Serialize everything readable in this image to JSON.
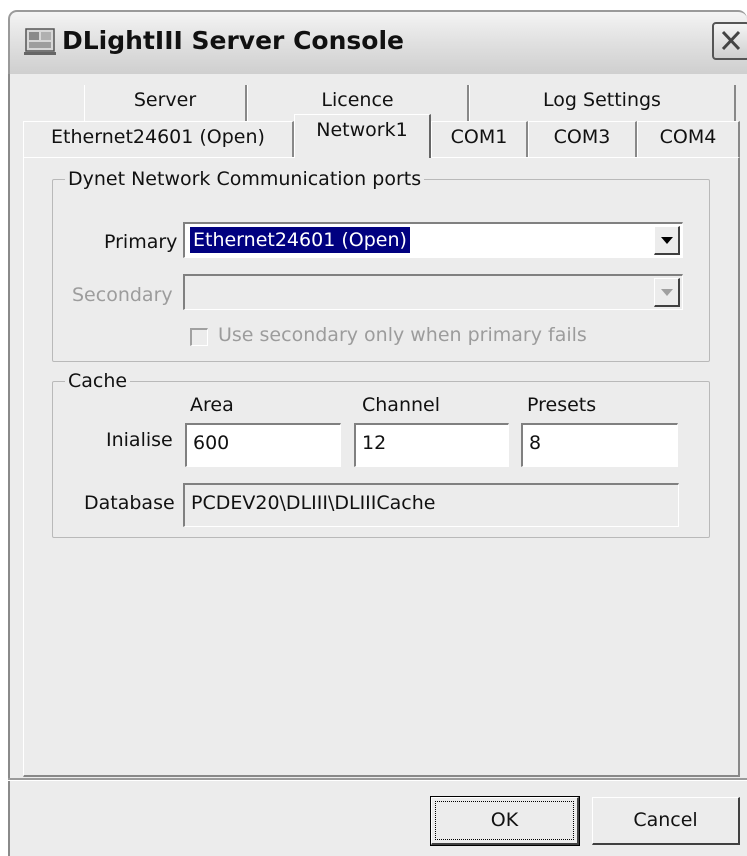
{
  "window": {
    "title": "DLightIII Server Console",
    "icon": "server-console-icon",
    "close_icon": "close-icon"
  },
  "tabs": {
    "row1": [
      "Server",
      "Licence",
      "Log Settings"
    ],
    "row2": [
      "Ethernet24601 (Open)",
      "Network1",
      "COM1",
      "COM3",
      "COM4"
    ],
    "active": "Network1"
  },
  "dynet": {
    "legend": "Dynet Network Communication ports",
    "primary_label": "Primary",
    "primary_value": "Ethernet24601 (Open)",
    "secondary_label": "Secondary",
    "secondary_value": "",
    "checkbox_label": "Use secondary only when primary fails",
    "checkbox_checked": false
  },
  "cache": {
    "legend": "Cache",
    "col_area": "Area",
    "col_channel": "Channel",
    "col_presets": "Presets",
    "init_label": "Inialise",
    "area_value": "600",
    "channel_value": "12",
    "presets_value": "8",
    "database_label": "Database",
    "database_value": "PCDEV20\\DLIII\\DLIIICache"
  },
  "buttons": {
    "ok": "OK",
    "cancel": "Cancel"
  },
  "colors": {
    "selection": "#000080",
    "face": "#ececec"
  }
}
